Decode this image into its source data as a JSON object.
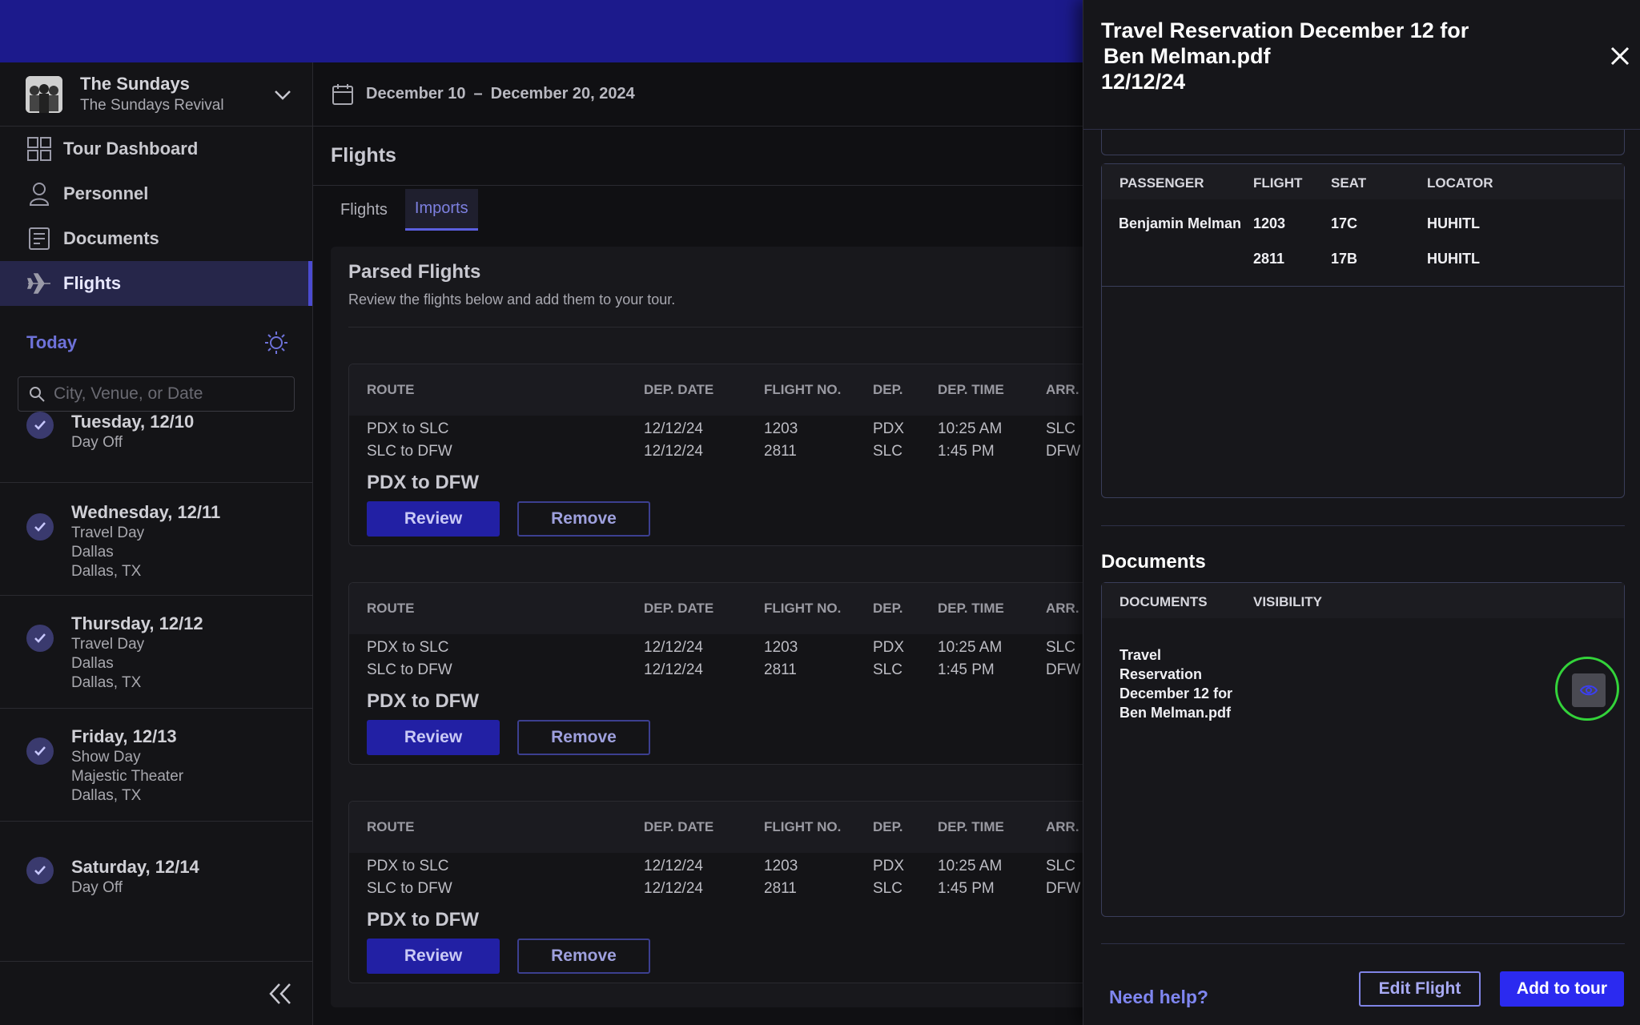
{
  "sidebar": {
    "tour_name": "The Sundays",
    "tour_sub": "The Sundays Revival",
    "nav": [
      {
        "label": "Tour Dashboard",
        "icon": "grid-icon"
      },
      {
        "label": "Personnel",
        "icon": "person-icon"
      },
      {
        "label": "Documents",
        "icon": "document-icon"
      },
      {
        "label": "Flights",
        "icon": "airplane-icon",
        "active": true
      }
    ],
    "today_label": "Today",
    "search_placeholder": "City, Venue, or Date",
    "days": [
      {
        "title": "Tuesday, 12/10",
        "lines": [
          "Day Off"
        ]
      },
      {
        "title": "Wednesday, 12/11",
        "lines": [
          "Travel Day",
          "Dallas",
          "Dallas, TX"
        ]
      },
      {
        "title": "Thursday, 12/12",
        "lines": [
          "Travel Day",
          "Dallas",
          "Dallas, TX"
        ]
      },
      {
        "title": "Friday, 12/13",
        "lines": [
          "Show Day",
          "Majestic Theater",
          "Dallas, TX"
        ]
      },
      {
        "title": "Saturday, 12/14",
        "lines": [
          "Day Off"
        ]
      }
    ]
  },
  "main": {
    "date_start": "December 10",
    "date_sep": "–",
    "date_end": "December 20, 2024",
    "page_title": "Flights",
    "tabs": [
      "Flights",
      "Imports"
    ],
    "active_tab": "Imports",
    "panel_title": "Parsed Flights",
    "panel_sub": "Review the flights below and add them to your tour.",
    "columns": [
      "ROUTE",
      "DEP. DATE",
      "FLIGHT NO.",
      "DEP.",
      "DEP. TIME",
      "ARR."
    ],
    "cards": [
      {
        "rows": [
          [
            "PDX to SLC",
            "12/12/24",
            "1203",
            "PDX",
            "10:25 AM",
            "SLC"
          ],
          [
            "SLC to DFW",
            "12/12/24",
            "2811",
            "SLC",
            "1:45 PM",
            "DFW"
          ]
        ],
        "route": "PDX to DFW",
        "review": "Review",
        "remove": "Remove"
      },
      {
        "rows": [
          [
            "PDX to SLC",
            "12/12/24",
            "1203",
            "PDX",
            "10:25 AM",
            "SLC"
          ],
          [
            "SLC to DFW",
            "12/12/24",
            "2811",
            "SLC",
            "1:45 PM",
            "DFW"
          ]
        ],
        "route": "PDX to DFW",
        "review": "Review",
        "remove": "Remove"
      },
      {
        "rows": [
          [
            "PDX to SLC",
            "12/12/24",
            "1203",
            "PDX",
            "10:25 AM",
            "SLC"
          ],
          [
            "SLC to DFW",
            "12/12/24",
            "2811",
            "SLC",
            "1:45 PM",
            "DFW"
          ]
        ],
        "route": "PDX to DFW",
        "review": "Review",
        "remove": "Remove"
      }
    ]
  },
  "drawer": {
    "title_line1": "Travel Reservation December 12 for",
    "title_line2": "Ben Melman.pdf",
    "title_line3": "12/12/24",
    "passenger_headers": [
      "PASSENGER",
      "FLIGHT",
      "SEAT",
      "LOCATOR"
    ],
    "passenger_rows": [
      [
        "Benjamin Melman",
        "1203",
        "17C",
        "HUHITL"
      ],
      [
        "",
        "2811",
        "17B",
        "HUHITL"
      ]
    ],
    "documents_title": "Documents",
    "doc_headers": [
      "DOCUMENTS",
      "VISIBILITY"
    ],
    "doc_name": "Travel Reservation December 12 for Ben Melman.pdf",
    "help_link": "Need help?",
    "edit_button": "Edit Flight",
    "add_button": "Add to tour"
  },
  "colors": {
    "banner": "#1c1a8c",
    "accent": "#2b2af0",
    "highlight_ring": "#33d33a"
  }
}
